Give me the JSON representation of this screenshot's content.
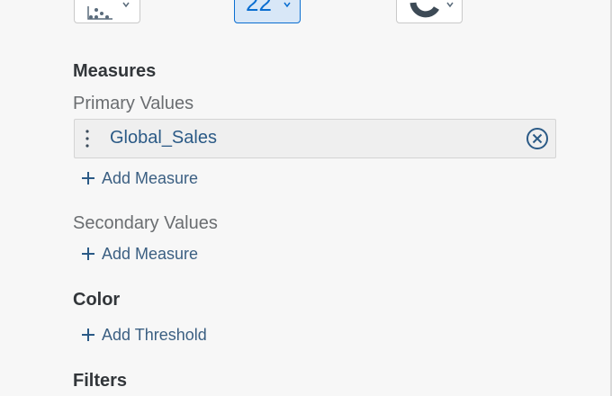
{
  "chart_types": [
    {
      "icon": "scatter-chart-icon",
      "selected": false
    },
    {
      "icon": "numeric-point-icon",
      "selected": true
    },
    {
      "icon": "donut-chart-icon",
      "selected": false
    }
  ],
  "measures": {
    "title": "Measures",
    "primary_label": "Primary Values",
    "primary_items": [
      {
        "name": "Global_Sales"
      }
    ],
    "primary_add_label": "Add Measure",
    "secondary_label": "Secondary Values",
    "secondary_add_label": "Add Measure"
  },
  "color": {
    "title": "Color",
    "add_threshold_label": "Add Threshold"
  },
  "filters": {
    "title": "Filters"
  },
  "colors": {
    "accent": "#0a6ed1",
    "link_text": "#3b5f82",
    "token_text": "#2b5a86",
    "background": "#f7f7f7"
  }
}
